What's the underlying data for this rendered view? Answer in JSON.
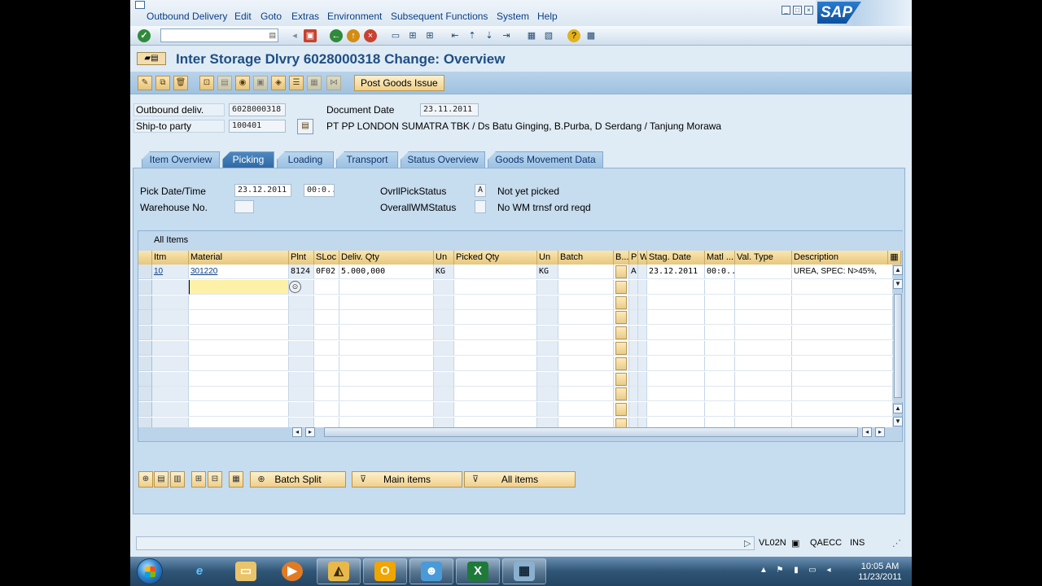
{
  "menu": {
    "items": [
      "Outbound Delivery",
      "Edit",
      "Goto",
      "Extras",
      "Environment",
      "Subsequent Functions",
      "System",
      "Help"
    ]
  },
  "logo_text": "SAP",
  "title": "Inter Storage Dlvry 6028000318 Change: Overview",
  "app_toolbar": {
    "post_goods_issue": "Post Goods Issue"
  },
  "header": {
    "outbound_label": "Outbound deliv.",
    "outbound_value": "6028000318",
    "ship_to_label": "Ship-to party",
    "ship_to_value": "100401",
    "doc_date_label": "Document Date",
    "doc_date_value": "23.11.2011",
    "ship_to_name": "PT PP LONDON SUMATRA TBK / Ds Batu Ginging, B.Purba, D Serdang / Tanjung Morawa"
  },
  "tabs": [
    "Item Overview",
    "Picking",
    "Loading",
    "Transport",
    "Status Overview",
    "Goods Movement Data"
  ],
  "active_tab": "Picking",
  "picking": {
    "pick_date_label": "Pick Date/Time",
    "pick_date_value": "23.12.2011",
    "pick_time_value": "00:0...",
    "warehouse_label": "Warehouse No.",
    "warehouse_value": "",
    "ovrl_pick_label": "OvrllPickStatus",
    "ovrl_pick_value": "A",
    "ovrl_pick_text": "Not yet picked",
    "ovrl_wm_label": "OverallWMStatus",
    "ovrl_wm_value": "",
    "ovrl_wm_text": "No WM trnsf ord reqd"
  },
  "table": {
    "title": "All Items",
    "columns": [
      "Itm",
      "Material",
      "Plnt",
      "SLoc",
      "Deliv. Qty",
      "Un",
      "Picked Qty",
      "Un",
      "Batch",
      "B...",
      "P",
      "W",
      "Stag. Date",
      "Matl ...",
      "Val. Type",
      "Description"
    ],
    "rows": [
      {
        "itm": "10",
        "material": "301220",
        "plnt": "8124",
        "sloc": "0F02",
        "deliv_qty": "5.000,000",
        "un": "KG",
        "picked_qty": "",
        "un2": "KG",
        "batch": "",
        "p": "A",
        "w": "",
        "stag_date": "23.12.2011",
        "matl": "00:0...",
        "val_type": "",
        "description": "UREA, SPEC: N>45%,"
      }
    ]
  },
  "bottom_buttons": {
    "batch_split": "Batch Split",
    "main_items": "Main items",
    "all_items": "All items"
  },
  "status_bar": {
    "transaction": "VL02N",
    "system": "QAECC",
    "mode": "INS"
  },
  "taskbar": {
    "time": "10:05 AM",
    "date": "11/23/2011"
  }
}
